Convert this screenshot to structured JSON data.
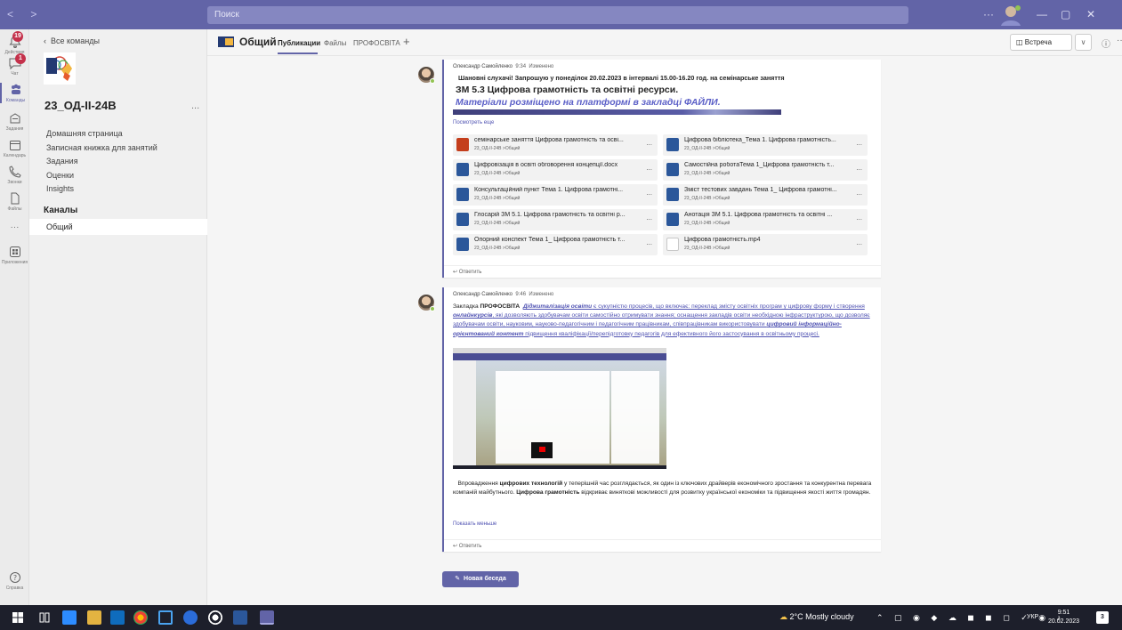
{
  "titlebar": {
    "search_placeholder": "Поиск"
  },
  "appbar": {
    "items": [
      {
        "label": "Действия",
        "badge": "19"
      },
      {
        "label": "Чат",
        "badge": "1"
      },
      {
        "label": "Команды",
        "badge": ""
      },
      {
        "label": "Задания",
        "badge": ""
      },
      {
        "label": "Календарь",
        "badge": ""
      },
      {
        "label": "Звонки",
        "badge": ""
      },
      {
        "label": "Файлы",
        "badge": ""
      },
      {
        "label": "",
        "badge": ""
      },
      {
        "label": "Приложения",
        "badge": ""
      }
    ],
    "help_label": "Справка"
  },
  "leftpane": {
    "back_label": "Все команды",
    "team_name": "23_ОД-ІІ-24В",
    "team_more": "...",
    "links": [
      "Домашняя страница",
      "Записная книжка для занятий",
      "Задания",
      "Оценки",
      "Insights"
    ],
    "channels_heading": "Каналы",
    "channel": "Общий"
  },
  "header": {
    "channel_name": "Общий",
    "tabs": [
      "Публикации",
      "Файлы",
      "ПРОФОСВІТА"
    ],
    "add_tab": "+",
    "meet_label": "Встреча",
    "meet_dropdown": "∨",
    "info": "ⓘ",
    "more": "···"
  },
  "message1": {
    "author": "Олександр Самойленко",
    "time": "9:34",
    "edited": "Изменено",
    "line1": "Шановні слухачі! Запрошую у понеділок 20.02.2023 в інтервалі 15.00-16.20 год. на семінарське заняття",
    "line2": "ЗМ 5.3 Цифрова грамотність та освітні ресурси.",
    "line3": "Матеріали розміщено на платформі в закладці ФАЙЛИ.",
    "see_more": "Посмотреть еще",
    "reply": "Ответить",
    "files": [
      {
        "name": "семінарське заняття Цифрова грамотність та осві...",
        "path": "23_ОД-ІІ-24В >Общий",
        "type": "ppt"
      },
      {
        "name": "Цифрова бібліотека_Тема 1. Цифрова грамотність...",
        "path": "23_ОД-ІІ-24В >Общий",
        "type": "word"
      },
      {
        "name": "Цифровізація в освіті обговорення концепції.docx",
        "path": "23_ОД-ІІ-24В >Общий",
        "type": "word"
      },
      {
        "name": "Самостійна роботаТема 1_Цифрова грамотність т...",
        "path": "23_ОД-ІІ-24В >Общий",
        "type": "word"
      },
      {
        "name": "Консультаційний пункт Тема 1. Цифрова грамотні...",
        "path": "23_ОД-ІІ-24В >Общий",
        "type": "word"
      },
      {
        "name": "Зміст тестових завдань Тема 1_ Цифрова грамотні...",
        "path": "23_ОД-ІІ-24В >Общий",
        "type": "word"
      },
      {
        "name": "Глосарій ЗМ 5.1. Цифрова грамотність та освітні р...",
        "path": "23_ОД-ІІ-24В >Общий",
        "type": "word"
      },
      {
        "name": "Анотація ЗМ 5.1. Цифрова грамотність та освітні ...",
        "path": "23_ОД-ІІ-24В >Общий",
        "type": "word"
      },
      {
        "name": "Опорний конспект Тема 1_ Цифрова грамотність т...",
        "path": "23_ОД-ІІ-24В >Общий",
        "type": "word"
      },
      {
        "name": "Цифрова грамотність.mp4",
        "path": "23_ОД-ІІ-24В >Общий",
        "type": "video"
      }
    ],
    "file_more": "..."
  },
  "message2": {
    "author": "Олександр Самойленко",
    "time": "9:46",
    "edited": "Изменено",
    "p1_prefix": "Закладка ",
    "p1_bold": "ПРОФОСВІТА",
    "p1_link1": "Діджиталізація освіти",
    "p1_text1": " є сукупністю процесів, що включає: переклад змісту освітніх програм у цифрову форму і створення ",
    "p1_link2": "онлайнкурсів",
    "p1_text2": ", які дозволяють здобувачам освіти самостійно отримувати знання; оснащення закладів освіти необхідною інфраструктурою, що дозволяє здобувачам освіти, науковим, науково-педагогічним і педагогічним працівникам, співпрацівникам використовувати ",
    "p1_link3": "цифровий інформаційно-орієнтований контент",
    "p1_text3": " підвищення кваліфікації/перепідготовку педагогів для ефективного його застосування в освітньому процесі.",
    "p2_text1": "Впровадження ",
    "p2_bold1": "цифрових технологій",
    "p2_text2": " у теперішній час розглядається, як один із ключових драйверів економічного зростання та конкурентна перевага компаній майбутнього. ",
    "p2_bold2": "Цифрова грамотність",
    "p2_text3": " відкриває виняткові можливості для розвитку української економіки та підвищення якості життя громадян.",
    "show_less": "Показать меньше",
    "reply": "Ответить"
  },
  "new_chat": "Новая беседа",
  "taskbar": {
    "weather": "2°C  Mostly cloudy",
    "lang": "УКР",
    "time": "9:51",
    "date": "20.02.2023",
    "notif_count": "3"
  },
  "colors": {
    "brand": "#6264a7",
    "taskbar": "#1d1f2b",
    "link": "#4f52b2"
  }
}
